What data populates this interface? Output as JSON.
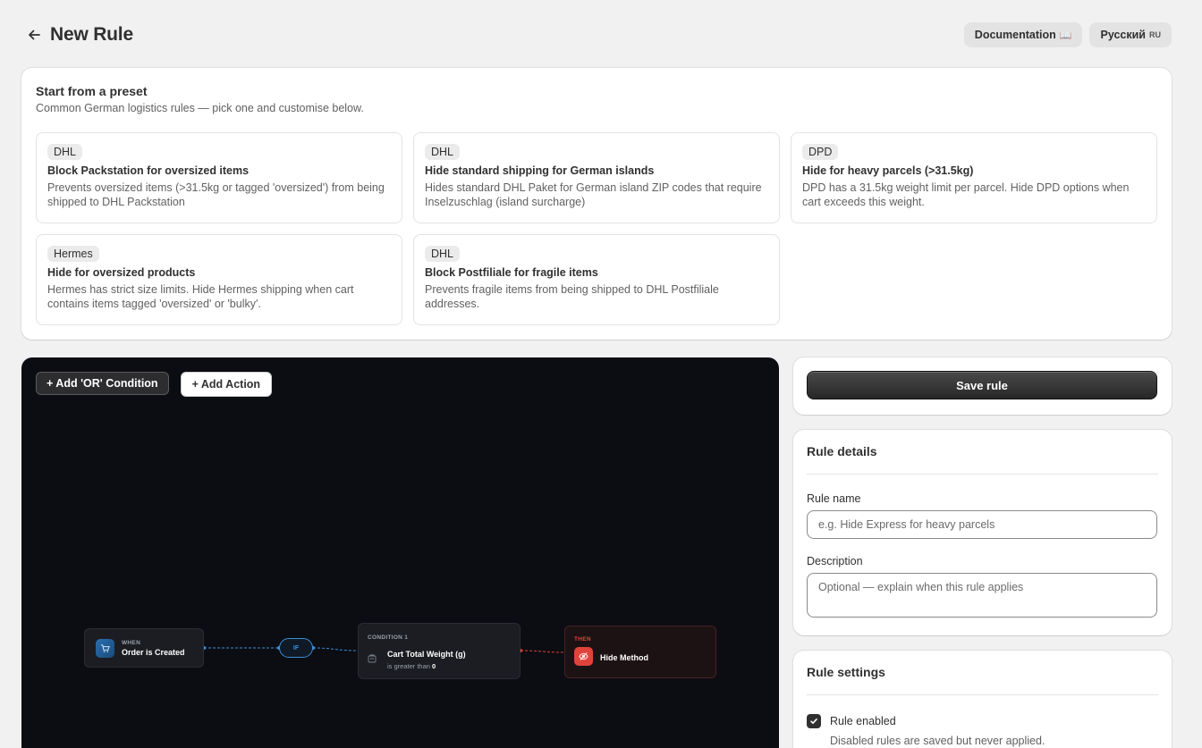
{
  "header": {
    "title": "New Rule",
    "documentation_label": "Documentation",
    "documentation_icon": "book-icon",
    "language_label": "Русский",
    "language_suffix": "RU"
  },
  "presets": {
    "title": "Start from a preset",
    "subtitle": "Common German logistics rules — pick one and customise below.",
    "items": [
      {
        "carrier": "DHL",
        "name": "Block Packstation for oversized items",
        "description": "Prevents oversized items (>31.5kg or tagged 'oversized') from being shipped to DHL Packstation"
      },
      {
        "carrier": "DHL",
        "name": "Hide standard shipping for German islands",
        "description": "Hides standard DHL Paket for German island ZIP codes that require Inselzuschlag (island surcharge)"
      },
      {
        "carrier": "DPD",
        "name": "Hide for heavy parcels (>31.5kg)",
        "description": "DPD has a 31.5kg weight limit per parcel. Hide DPD options when cart exceeds this weight."
      },
      {
        "carrier": "Hermes",
        "name": "Hide for oversized products",
        "description": "Hermes has strict size limits. Hide Hermes shipping when cart contains items tagged 'oversized' or 'bulky'."
      },
      {
        "carrier": "DHL",
        "name": "Block Postfiliale for fragile items",
        "description": "Prevents fragile items from being shipped to DHL Postfiliale addresses."
      }
    ]
  },
  "canvas": {
    "add_or_label": "+ Add 'OR' Condition",
    "add_action_label": "+ Add Action",
    "when_label": "WHEN",
    "when_text": "Order is Created",
    "if_label": "IF",
    "condition_label": "CONDITION 1",
    "condition_field": "Cart Total Weight (g)",
    "condition_operator": "is greater than",
    "condition_value": "0",
    "then_label": "THEN",
    "then_text": "Hide Method",
    "colors": {
      "background": "#0c0d12",
      "connector_blue": "#3b8ed8",
      "connector_red": "#e0433b"
    }
  },
  "save": {
    "label": "Save rule"
  },
  "details": {
    "title": "Rule details",
    "name_label": "Rule name",
    "name_placeholder": "e.g. Hide Express for heavy parcels",
    "desc_label": "Description",
    "desc_placeholder": "Optional — explain when this rule applies"
  },
  "settings": {
    "title": "Rule settings",
    "enabled_label": "Rule enabled",
    "enabled_checked": true,
    "enabled_help": "Disabled rules are saved but never applied."
  }
}
